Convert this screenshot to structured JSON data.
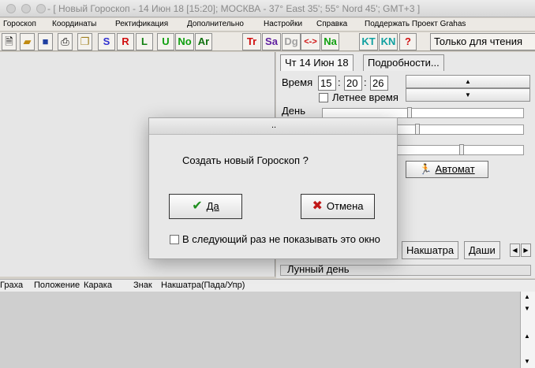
{
  "window": {
    "title": "- [ Новый Гороскоп - 14 Июн 18 [15:20]; МОСКВА - 37° East 35'; 55° Nord 45'; GMT+3 ]"
  },
  "menu": [
    "Гороскоп",
    "Координаты",
    "Ректификация",
    "Дополнительно",
    "Настройки",
    "Справка",
    "Поддержать Проект Grahas"
  ],
  "toolbar": {
    "icons": [
      "new-file-icon",
      "open-folder-icon",
      "save-disk-icon",
      "print-icon",
      "copy-icon"
    ],
    "buttons": [
      {
        "label": "S",
        "color": "#3030d0"
      },
      {
        "label": "R",
        "color": "#d01010"
      },
      {
        "label": "L",
        "color": "#108010"
      },
      {
        "label": "U",
        "color": "#10a010"
      },
      {
        "label": "No",
        "color": "#10a010"
      },
      {
        "label": "Ar",
        "color": "#107010"
      },
      {
        "label": "Tr",
        "color": "#d01010"
      },
      {
        "label": "Sa",
        "color": "#6020a0"
      },
      {
        "label": "Dg",
        "color": "#a0a0a0"
      },
      {
        "label": "<->",
        "color": "#d01010"
      },
      {
        "label": "Na",
        "color": "#10a010"
      },
      {
        "label": "KT",
        "color": "#10a0a0"
      },
      {
        "label": "KN",
        "color": "#10a0a0"
      },
      {
        "label": "?",
        "color": "#d01010"
      }
    ],
    "readonly_label": "Только для чтения"
  },
  "tabs": [
    "Чт 14 Июн 18",
    "Подробности..."
  ],
  "time": {
    "label": "Время",
    "hours": "15",
    "minutes": "20",
    "seconds": "26",
    "separator": ":",
    "dst_label": "Летнее время"
  },
  "day_label": "День",
  "automat_label": "Автомат",
  "bottom_tabs": [
    "Накшатра",
    "Даши"
  ],
  "status": {
    "lunar_day": "Лунный день"
  },
  "columns": [
    "Граха",
    "Положение",
    "Карака",
    "Знак",
    "Накшатра(Пада/Упр)"
  ],
  "dialog": {
    "title": "..",
    "message": "Создать новый Гороскоп ?",
    "yes_label": "Да",
    "cancel_label": "Отмена",
    "dont_show_label": "В следующий раз не показывать это окно",
    "yes_color": "#1f8f1f",
    "cancel_color": "#c01818"
  }
}
